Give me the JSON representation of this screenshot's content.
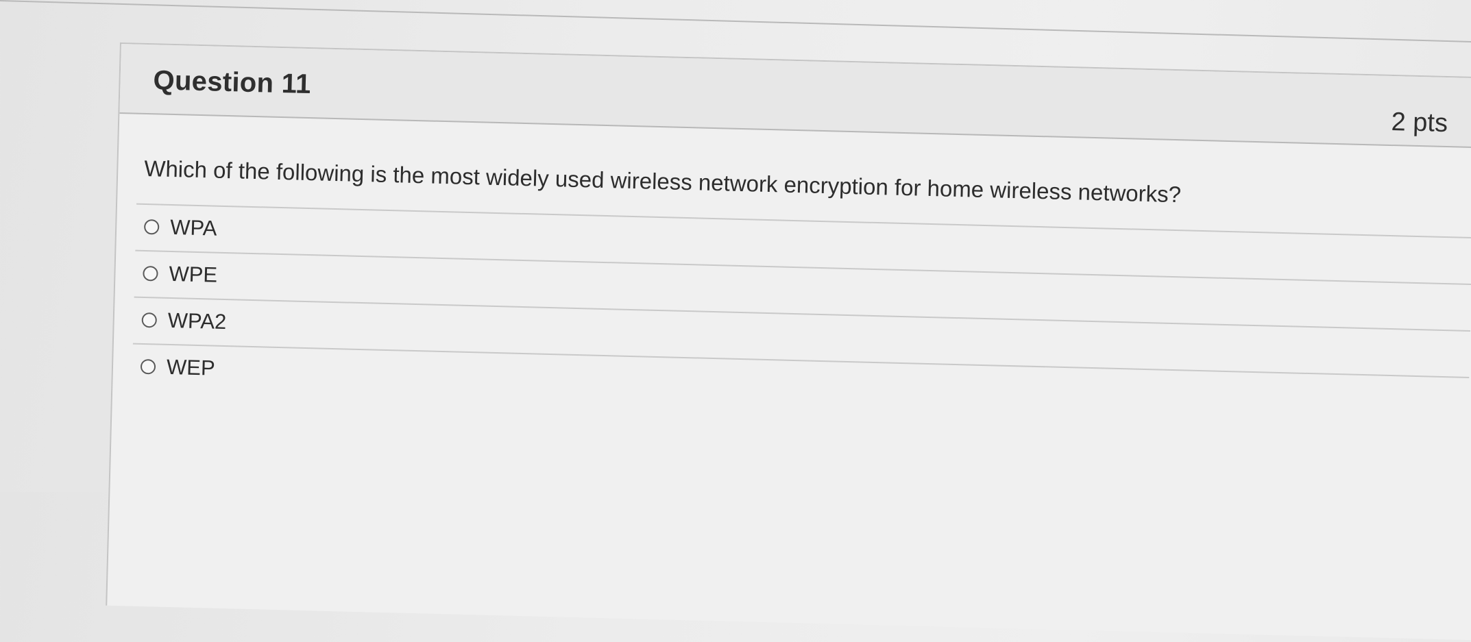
{
  "question": {
    "title": "Question 11",
    "points": "2 pts",
    "prompt": "Which of the following is the most widely used wireless network encryption for home wireless networks?",
    "answers": [
      {
        "label": "WPA",
        "selected": false
      },
      {
        "label": "WPE",
        "selected": false
      },
      {
        "label": "WPA2",
        "selected": false
      },
      {
        "label": "WEP",
        "selected": false
      }
    ]
  }
}
